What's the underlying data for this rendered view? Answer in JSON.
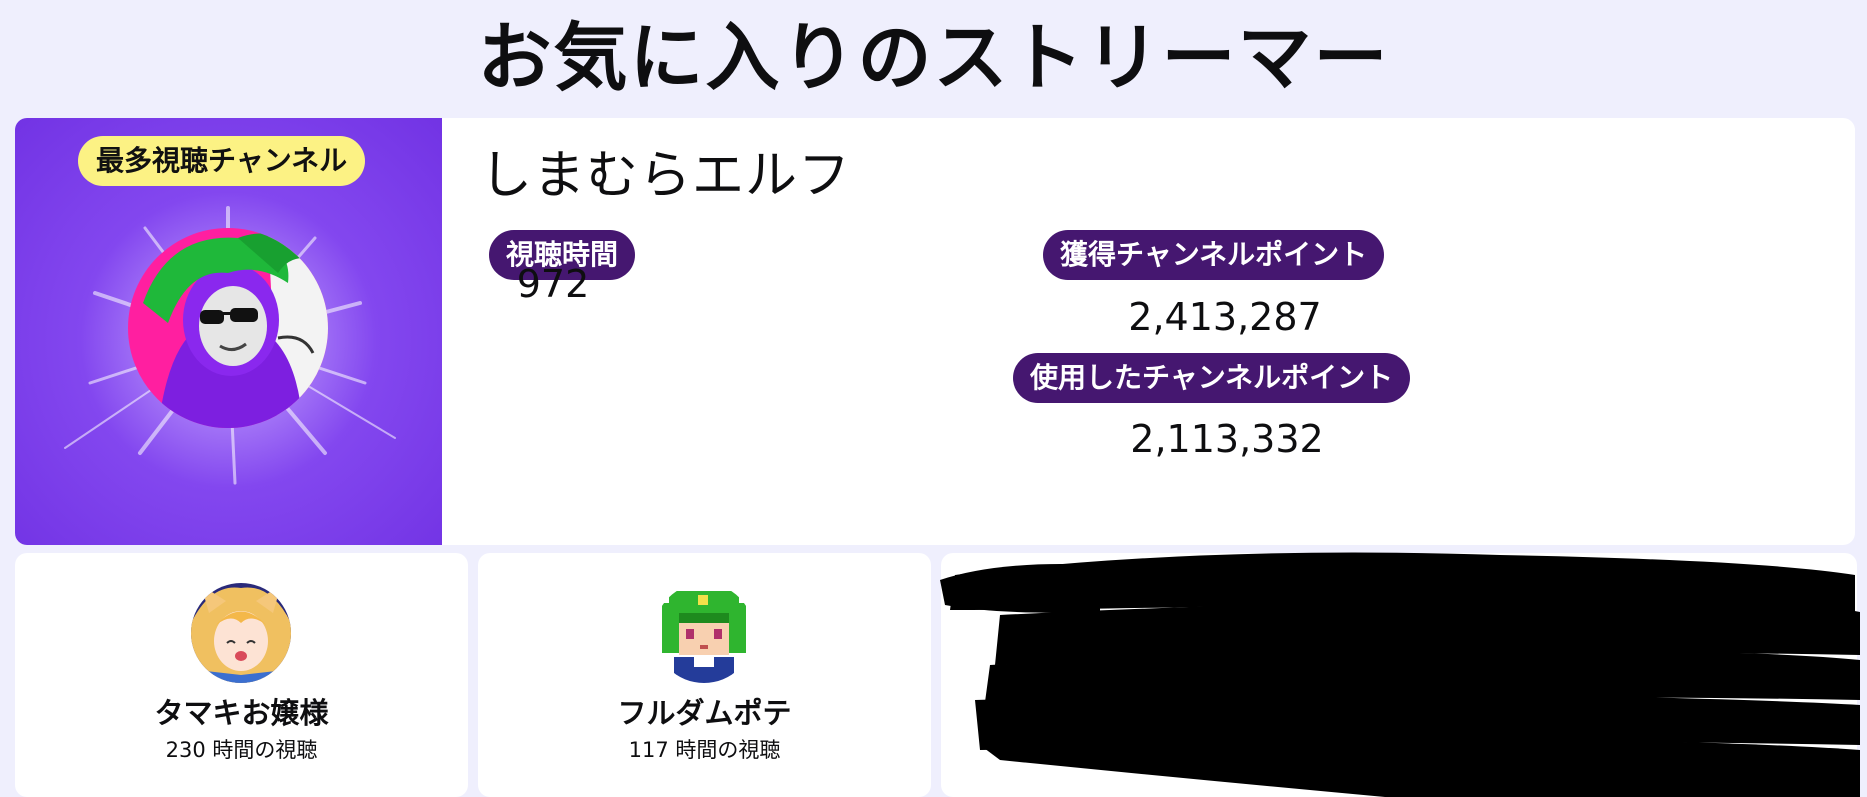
{
  "page": {
    "title": "お気に入りのストリーマー"
  },
  "top_streamer": {
    "badge": "最多視聴チャンネル",
    "name": "しまむらエルフ",
    "stats": {
      "watch_time_label": "視聴時間",
      "watch_time_value": "972",
      "earned_points_label": "獲得チャンネルポイント",
      "earned_points_value": "2,413,287",
      "spent_points_label": "使用したチャンネルポイント",
      "spent_points_value": "2,113,332"
    },
    "colors": {
      "hero_background": "#7233e4",
      "badge_background": "#fcf284",
      "pill_background": "#451770"
    }
  },
  "other_streamers": [
    {
      "name": "タマキお嬢様",
      "hours": "230 時間の視聴"
    },
    {
      "name": "フルダムポテ",
      "hours": "117 時間の視聴"
    }
  ],
  "redacted_cards_count_note": "",
  "colors": {
    "page_background": "#efeffd",
    "card_background": "#ffffff",
    "redaction": "#000000"
  }
}
